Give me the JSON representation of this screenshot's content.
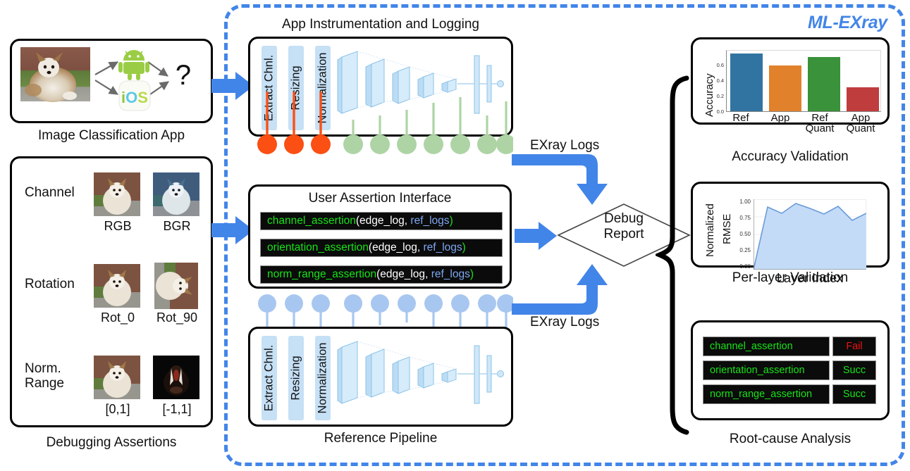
{
  "brand": {
    "logo": "ML-EXray"
  },
  "left": {
    "app_panel": {
      "caption": "Image Classification App",
      "question_mark": "?",
      "platforms": [
        "android-icon",
        "ios-icon"
      ]
    },
    "assertions_panel": {
      "caption": "Debugging Assertions",
      "rows": [
        {
          "label": "Channel",
          "left_caption": "RGB",
          "right_caption": "BGR"
        },
        {
          "label": "Rotation",
          "left_caption": "Rot_0",
          "right_caption": "Rot_90"
        },
        {
          "label": "Norm.\nRange",
          "label_line1": "Norm.",
          "label_line2": "Range",
          "left_caption": "[0,1]",
          "right_caption": "[-1,1]"
        }
      ]
    }
  },
  "middle": {
    "instrumentation": {
      "title": "App Instrumentation and Logging",
      "stages": [
        "Extract Chnl.",
        "Resizing",
        "Normalization"
      ],
      "log_dots_preprocess": 3,
      "log_dots_model": 7,
      "preprocess_dot_color": "#fb4f14",
      "model_dot_color": "#aed4a5"
    },
    "assertion_interface": {
      "title": "User Assertion Interface",
      "lines": [
        {
          "fn": "channel_assertion",
          "open": "(",
          "arg1": "edge_log",
          "comma": ", ",
          "arg2": "ref_logs",
          "close": ")"
        },
        {
          "fn": "orientation_assertion",
          "open": "(",
          "arg1": "edge_log",
          "comma": ", ",
          "arg2": "ref_logs",
          "close": ")"
        },
        {
          "fn": "norm_range_assertion",
          "open": "(",
          "arg1": "edge_log",
          "comma": ", ",
          "arg2": "ref_logs",
          "close": ")"
        }
      ]
    },
    "reference_pipeline": {
      "title": "Reference Pipeline",
      "stages": [
        "Extract Chnl.",
        "Resizing",
        "Normalization"
      ],
      "log_dots": 10,
      "dot_color": "#a8c7f0"
    },
    "flow": {
      "logs_label_top": "EXray Logs",
      "logs_label_bottom": "EXray Logs",
      "debug_report_line1": "Debug",
      "debug_report_line2": "Report",
      "arrow_color": "#4285e8"
    }
  },
  "right": {
    "accuracy_panel": {
      "caption": "Accuracy Validation"
    },
    "perlayer_panel": {
      "caption": "Per-layer Validation"
    },
    "rootcause_panel": {
      "caption": "Root-cause Analysis",
      "rows": [
        {
          "name": "channel_assertion",
          "status": "Fail",
          "status_color": "#f01010"
        },
        {
          "name": "orientation_assertion",
          "status": "Succ",
          "status_color": "#17e317"
        },
        {
          "name": "norm_range_assertion",
          "status": "Succ",
          "status_color": "#17e317"
        }
      ]
    }
  },
  "chart_data": [
    {
      "type": "bar",
      "title": "Accuracy Validation",
      "categories": [
        "Ref",
        "App",
        "Ref Quant",
        "App Quant"
      ],
      "category_lines": [
        [
          "Ref",
          ""
        ],
        [
          "App",
          ""
        ],
        [
          "Ref",
          "Quant"
        ],
        [
          "App",
          "Quant"
        ]
      ],
      "values": [
        0.71,
        0.57,
        0.66,
        0.3
      ],
      "colors": [
        "#3274a1",
        "#e1812c",
        "#3a923a",
        "#c03d3e"
      ],
      "xlabel": "",
      "ylabel": "Accuracy",
      "ylim": [
        0.0,
        0.74
      ],
      "yticks": [
        0.0,
        0.2,
        0.4,
        0.6
      ],
      "ytick_labels": [
        "0.0",
        "0.2",
        "0.4",
        "0.6"
      ],
      "grid": false,
      "legend": "none"
    },
    {
      "type": "area",
      "title": "Per-layer Validation",
      "x": [
        0,
        1,
        2,
        3,
        4,
        5,
        6,
        7,
        8
      ],
      "values": [
        0.0,
        0.89,
        0.8,
        0.94,
        0.87,
        0.79,
        0.9,
        0.7,
        0.8
      ],
      "xlabel": "Layer Index",
      "ylabel": "Normalized RMSE",
      "ylabel_line1": "Normalized",
      "ylabel_line2": "RMSE",
      "ylim": [
        0.0,
        1.0
      ],
      "yticks": [
        0.0,
        0.25,
        0.5,
        0.75,
        1.0
      ],
      "ytick_labels": [
        "0.00",
        "0.25",
        "0.50",
        "0.75",
        "1.00"
      ],
      "line_color": "#6c9bd9",
      "fill_color": "#c3dbf7",
      "grid": true,
      "legend": "none"
    }
  ]
}
